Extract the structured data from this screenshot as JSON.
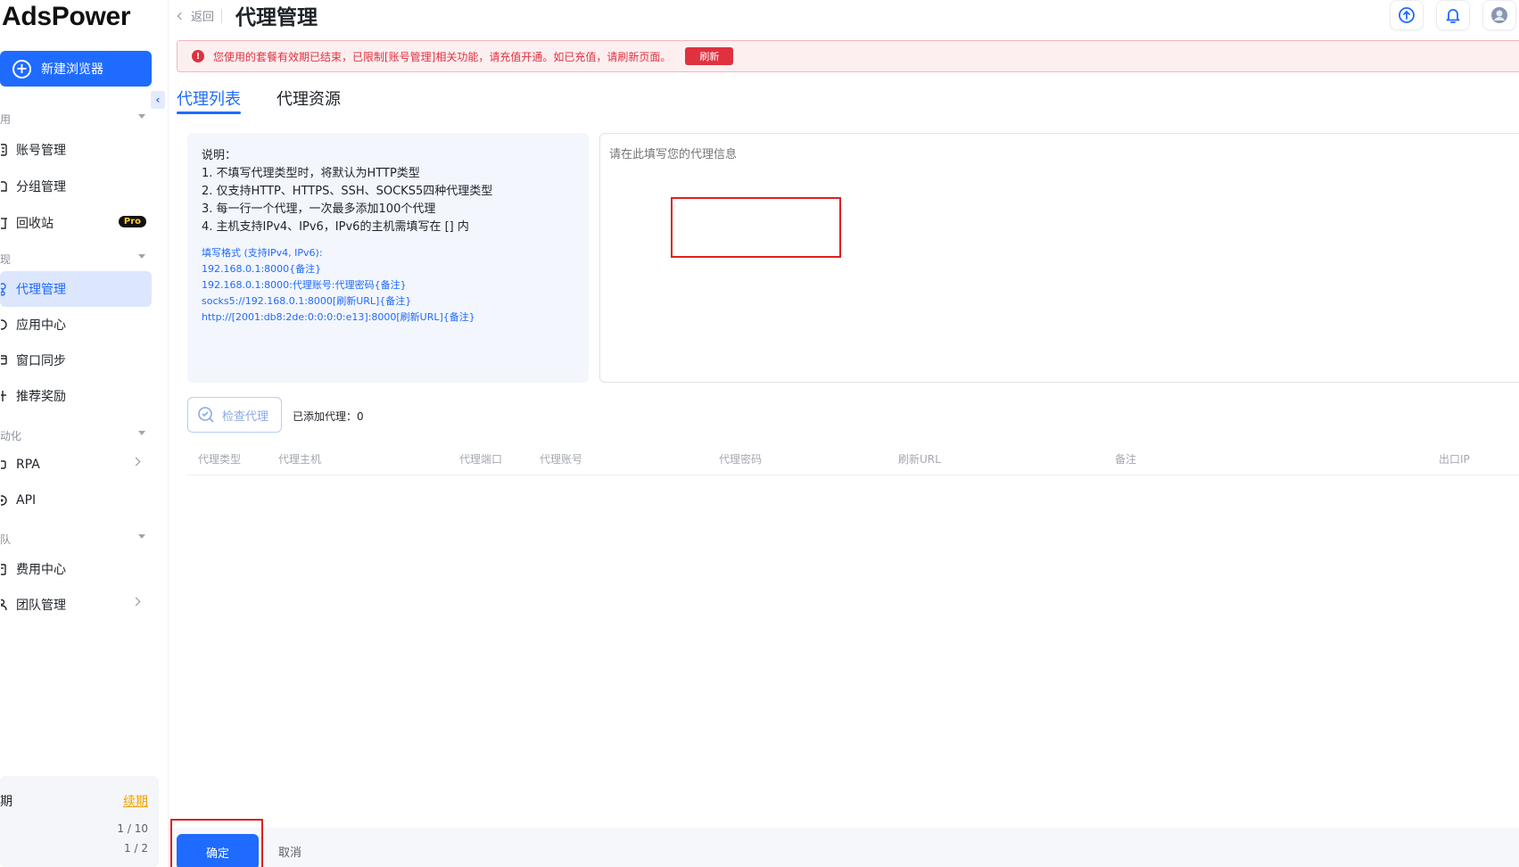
{
  "app": {
    "logo": "AdsPower"
  },
  "sidebar": {
    "new_browser_label": "新建浏览器",
    "sections": [
      {
        "title": "用"
      },
      {
        "title": "现"
      },
      {
        "title": "动化"
      },
      {
        "title": "队"
      }
    ],
    "items": [
      {
        "label": "账号管理"
      },
      {
        "label": "分组管理"
      },
      {
        "label": "回收站",
        "badge": "Pro"
      },
      {
        "label": "代理管理",
        "active": true
      },
      {
        "label": "应用中心"
      },
      {
        "label": "窗口同步"
      },
      {
        "label": "推荐奖励"
      },
      {
        "label": "RPA"
      },
      {
        "label": "API"
      },
      {
        "label": "费用中心"
      },
      {
        "label": "团队管理"
      }
    ],
    "plan": {
      "title": "期",
      "renew_label": "续期",
      "row1_label": "",
      "row1_value": "1 / 10",
      "row2_label": "",
      "row2_value": "1 / 2"
    }
  },
  "header": {
    "back_label": "返回",
    "title": "代理管理"
  },
  "alert": {
    "message": "您使用的套餐有效期已结束，已限制[账号管理]相关功能，请充值开通。如已充值，请刷新页面。",
    "refresh_label": "刷新",
    "color": "#e0313f"
  },
  "tabs": [
    {
      "label": "代理列表",
      "active": true
    },
    {
      "label": "代理资源"
    }
  ],
  "info": {
    "heading": "说明：",
    "lines": [
      "1. 不填写代理类型时，将默认为HTTP类型",
      "2. 仅支持HTTP、HTTPS、SSH、SOCKS5四种代理类型",
      "3. 每一行一个代理，一次最多添加100个代理",
      "4. 主机支持IPv4、IPv6，IPv6的主机需填写在 [] 内"
    ],
    "format_title": "填写格式 (支持IPv4, IPv6):",
    "formats": [
      "192.168.0.1:8000{备注}",
      "192.168.0.1:8000:代理账号:代理密码{备注}",
      "socks5://192.168.0.1:8000[刷新URL]{备注}",
      "http://[2001:db8:2de:0:0:0:0:e13]:8000[刷新URL]{备注}"
    ]
  },
  "proxy_input": {
    "value": "",
    "placeholder": "请在此填写您的代理信息"
  },
  "check": {
    "button_label": "检查代理",
    "added_label": "已添加代理：0"
  },
  "table": {
    "columns": [
      "代理类型",
      "代理主机",
      "代理端口",
      "代理账号",
      "代理密码",
      "刷新URL",
      "备注",
      "出口IP"
    ],
    "rows": []
  },
  "footer": {
    "ok_label": "确定",
    "cancel_label": "取消"
  },
  "colors": {
    "accent": "#1f6bff",
    "danger": "#e0313f",
    "renew": "#f2a100"
  }
}
